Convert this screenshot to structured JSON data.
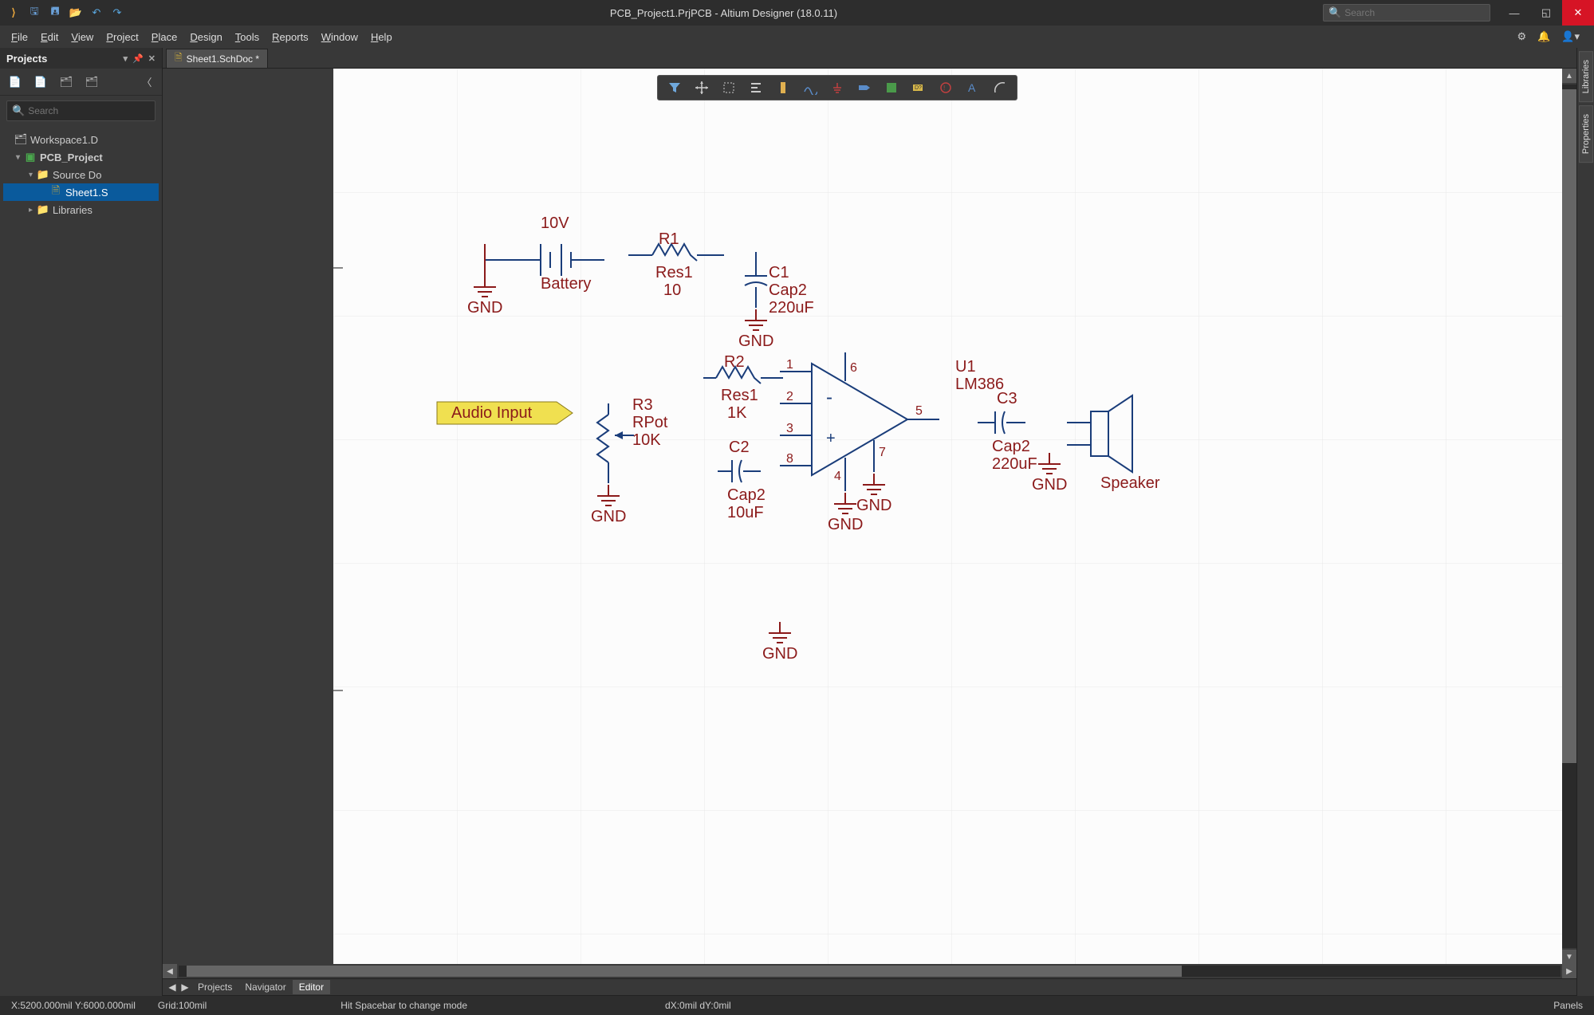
{
  "titlebar": {
    "title": "PCB_Project1.PrjPCB - Altium Designer (18.0.11)",
    "search_placeholder": "Search"
  },
  "menubar": {
    "items": [
      "File",
      "Edit",
      "View",
      "Project",
      "Place",
      "Design",
      "Tools",
      "Reports",
      "Window",
      "Help"
    ]
  },
  "projects_panel": {
    "title": "Projects",
    "search_placeholder": "Search",
    "tree": [
      {
        "label": "Workspace1.D",
        "indent": 0,
        "icon": "workspace",
        "caret": ""
      },
      {
        "label": "PCB_Project",
        "indent": 1,
        "icon": "project",
        "caret": "▾",
        "bold": true
      },
      {
        "label": "Source Do",
        "indent": 2,
        "icon": "folder",
        "caret": "▾"
      },
      {
        "label": "Sheet1.S",
        "indent": 3,
        "icon": "doc",
        "caret": "",
        "selected": true
      },
      {
        "label": "Libraries",
        "indent": 2,
        "icon": "folder",
        "caret": "▸"
      }
    ]
  },
  "tabs": [
    {
      "label": "Sheet1.SchDoc *"
    }
  ],
  "right_rail": [
    "Libraries",
    "Properties"
  ],
  "bottom_tabs": {
    "left_arrow": "◀",
    "right_arrow": "▶",
    "items": [
      "Projects",
      "Navigator",
      "Editor"
    ],
    "active": "Editor"
  },
  "statusbar": {
    "coords": "X:5200.000mil Y:6000.000mil",
    "grid": "Grid:100mil",
    "hint": "Hit Spacebar to change mode",
    "delta": "dX:0mil dY:0mil",
    "panels": "Panels"
  },
  "float_toolbar_count": 13,
  "schematic": {
    "port_label": "Audio Input",
    "battery": {
      "voltage": "10V",
      "designator": "Battery"
    },
    "gnd": "GND",
    "r1": {
      "designator": "R1",
      "comment": "Res1",
      "value": "10"
    },
    "r2": {
      "designator": "R2",
      "comment": "Res1",
      "value": "1K"
    },
    "r3": {
      "designator": "R3",
      "comment": "RPot",
      "value": "10K"
    },
    "c1": {
      "designator": "C1",
      "comment": "Cap2",
      "value": "220uF"
    },
    "c2": {
      "designator": "C2",
      "comment": "Cap2",
      "value": "10uF"
    },
    "c3": {
      "designator": "C3",
      "comment": "Cap2",
      "value": "220uF"
    },
    "u1": {
      "designator": "U1",
      "comment": "LM386",
      "pins": {
        "p1": "1",
        "p2": "2",
        "p3": "3",
        "p5": "5",
        "p6": "6",
        "p7": "7",
        "p8": "8"
      }
    },
    "speaker": "Speaker"
  }
}
